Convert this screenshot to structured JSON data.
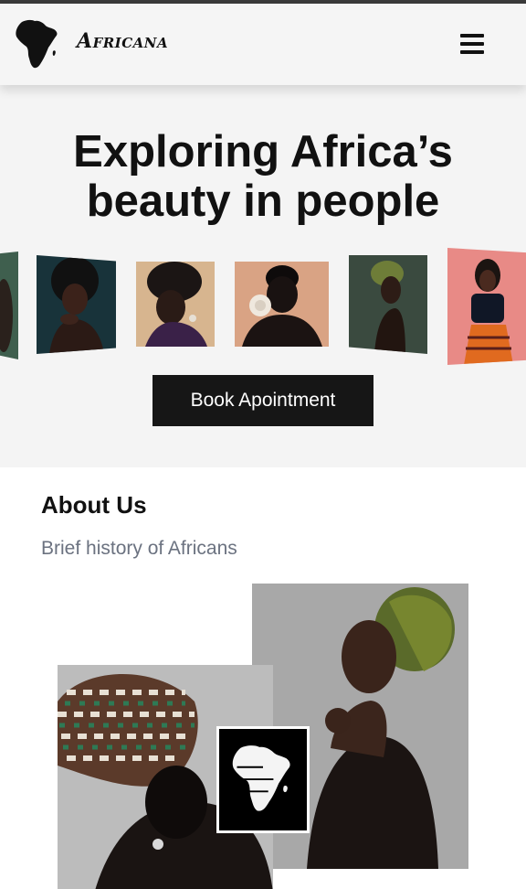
{
  "header": {
    "brand": "Africana",
    "logo_icon": "africa-map-icon",
    "menu_icon": "hamburger-menu-icon"
  },
  "hero": {
    "title_line1": "Exploring Africa’s",
    "title_line2": "beauty in people",
    "book_button": "Book Apointment",
    "gallery": [
      {
        "name": "portrait-green-partial",
        "bg": "#3f5f4e"
      },
      {
        "name": "portrait-afro-teal",
        "bg": "#18333a"
      },
      {
        "name": "portrait-headwrap-beige",
        "bg": "#d7b58f"
      },
      {
        "name": "portrait-flower-peach",
        "bg": "#d9a384"
      },
      {
        "name": "portrait-headwrap-green",
        "bg": "#3a4a3f"
      },
      {
        "name": "portrait-pink-dress",
        "bg": "#e88a86"
      }
    ]
  },
  "about": {
    "title": "About Us",
    "subtitle": "Brief history of Africans",
    "badge_icon": "africa-map-icon"
  },
  "colors": {
    "accent": "#161616",
    "muted_text": "#6b7280",
    "hero_bg": "#f4f4f4"
  }
}
